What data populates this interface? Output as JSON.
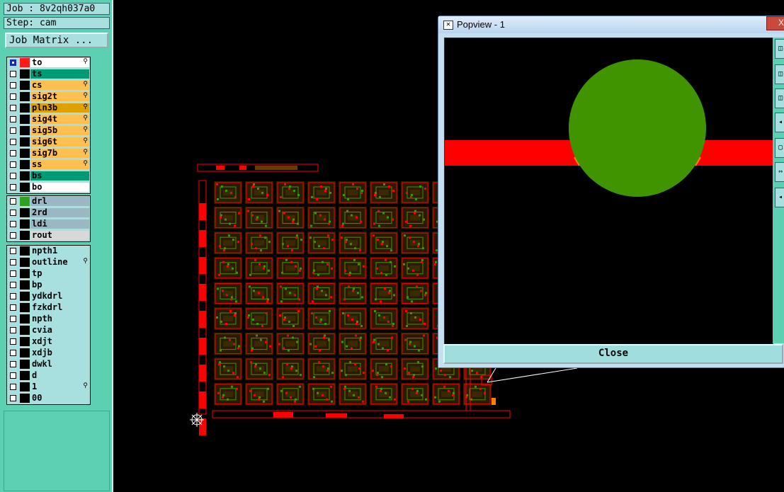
{
  "job_line": "Job : 8v2qh037a0",
  "step_line": "Step: cam",
  "job_matrix_label": "Job Matrix ...",
  "groups": [
    [
      {
        "name": "to",
        "swatch": "#ff1a1a",
        "bg": "#ffffff",
        "mark": "⚲",
        "selected": true
      },
      {
        "name": "ts",
        "swatch": "#000000",
        "bg": "#009a74",
        "mark": ""
      },
      {
        "name": "cs",
        "swatch": "#000000",
        "bg": "#ffc050",
        "mark": "⚲"
      },
      {
        "name": "sig2t",
        "swatch": "#000000",
        "bg": "#ffc050",
        "mark": "⚲"
      },
      {
        "name": "pln3b",
        "swatch": "#000000",
        "bg": "#e0a000",
        "mark": "⚲"
      },
      {
        "name": "sig4t",
        "swatch": "#000000",
        "bg": "#ffc050",
        "mark": "⚲"
      },
      {
        "name": "sig5b",
        "swatch": "#000000",
        "bg": "#ffc050",
        "mark": "⚲"
      },
      {
        "name": "sig6t",
        "swatch": "#000000",
        "bg": "#ffc050",
        "mark": "⚲"
      },
      {
        "name": "sig7b",
        "swatch": "#000000",
        "bg": "#ffc050",
        "mark": "⚲"
      },
      {
        "name": "ss",
        "swatch": "#000000",
        "bg": "#ffc050",
        "mark": "⚲"
      },
      {
        "name": "bs",
        "swatch": "#000000",
        "bg": "#009a74",
        "mark": ""
      },
      {
        "name": "bo",
        "swatch": "#000000",
        "bg": "#ffffff",
        "mark": ""
      }
    ],
    [
      {
        "name": "drl",
        "swatch": "#2fa020",
        "bg": "#9ab8c4",
        "mark": ""
      },
      {
        "name": "2rd",
        "swatch": "#000000",
        "bg": "#9ab8c4",
        "mark": ""
      },
      {
        "name": "ldi",
        "swatch": "#000000",
        "bg": "#9ab8c4",
        "mark": ""
      },
      {
        "name": "rout",
        "swatch": "#000000",
        "bg": "#d8d8d8",
        "mark": ""
      }
    ],
    [
      {
        "name": "npth1",
        "swatch": "#000000",
        "bg": "#a8e0e0",
        "mark": ""
      },
      {
        "name": "outline",
        "swatch": "#000000",
        "bg": "#a8e0e0",
        "mark": "⚲"
      },
      {
        "name": "tp",
        "swatch": "#000000",
        "bg": "#a8e0e0",
        "mark": ""
      },
      {
        "name": "bp",
        "swatch": "#000000",
        "bg": "#a8e0e0",
        "mark": ""
      },
      {
        "name": "ydkdrl",
        "swatch": "#000000",
        "bg": "#a8e0e0",
        "mark": ""
      },
      {
        "name": "fzkdrl",
        "swatch": "#000000",
        "bg": "#a8e0e0",
        "mark": ""
      },
      {
        "name": "npth",
        "swatch": "#000000",
        "bg": "#a8e0e0",
        "mark": ""
      },
      {
        "name": "cvia",
        "swatch": "#000000",
        "bg": "#a8e0e0",
        "mark": ""
      },
      {
        "name": "xdjt",
        "swatch": "#000000",
        "bg": "#a8e0e0",
        "mark": ""
      },
      {
        "name": "xdjb",
        "swatch": "#000000",
        "bg": "#a8e0e0",
        "mark": ""
      },
      {
        "name": "dwkl",
        "swatch": "#000000",
        "bg": "#a8e0e0",
        "mark": ""
      },
      {
        "name": "d",
        "swatch": "#000000",
        "bg": "#a8e0e0",
        "mark": ""
      },
      {
        "name": "1",
        "swatch": "#000000",
        "bg": "#a8e0e0",
        "mark": "⚲"
      },
      {
        "name": "00",
        "swatch": "#000000",
        "bg": "#a8e0e0",
        "mark": ""
      }
    ]
  ],
  "popview": {
    "title": "Popview - 1",
    "close_x": "X",
    "close_label": "Close"
  },
  "colors": {
    "trace": "#ff0000",
    "pad": "#3f9400",
    "panel": "#5cd0b0"
  },
  "icons": [
    "origin-crosshair-icon",
    "popview-window-icon",
    "zoom-tool-icons"
  ]
}
